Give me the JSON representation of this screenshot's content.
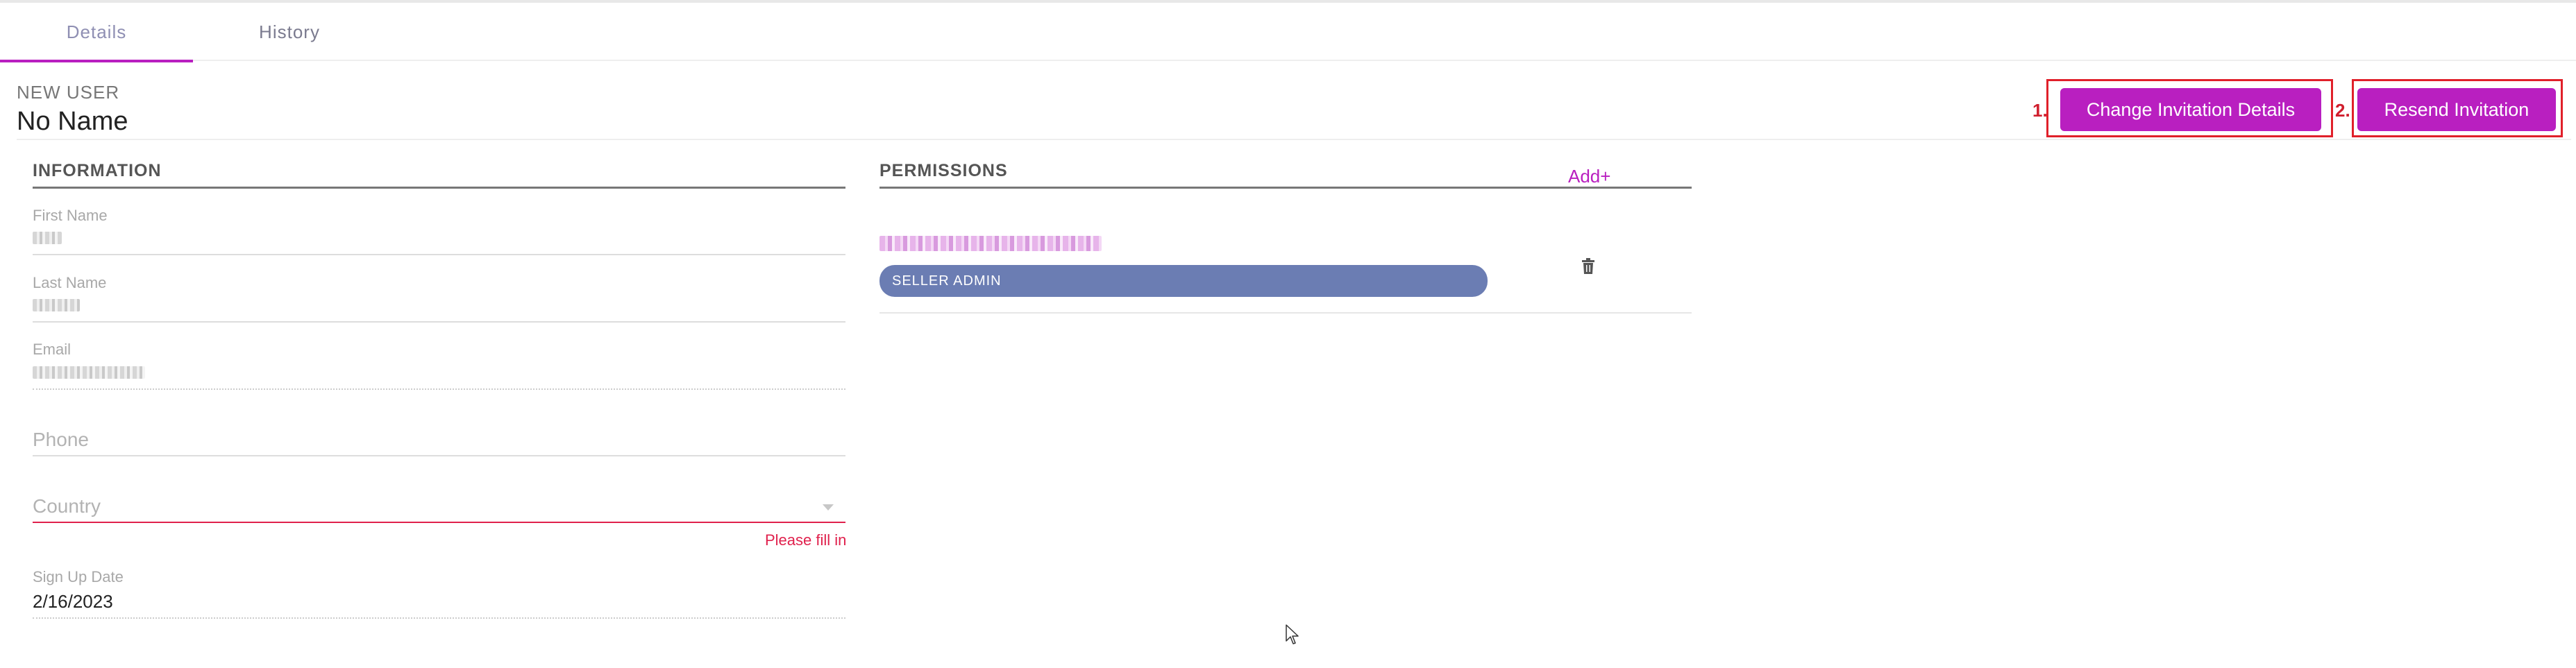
{
  "tabs": [
    {
      "label": "Details",
      "active": true
    },
    {
      "label": "History",
      "active": false
    }
  ],
  "header": {
    "subtitle": "NEW USER",
    "name": "No Name"
  },
  "actions": {
    "change_label": "Change Invitation Details",
    "change_annotation": "1.",
    "resend_label": "Resend Invitation",
    "resend_annotation": "2."
  },
  "information": {
    "title": "INFORMATION",
    "first_name_label": "First Name",
    "last_name_label": "Last Name",
    "email_label": "Email",
    "phone_placeholder": "Phone",
    "country_placeholder": "Country",
    "country_error": "Please fill in",
    "signup_label": "Sign Up Date",
    "signup_value": "2/16/2023"
  },
  "permissions": {
    "title": "PERMISSIONS",
    "add_label": "Add+",
    "role": "SELLER ADMIN"
  },
  "colors": {
    "accent": "#b91fc0",
    "pill": "#6b7db3",
    "error": "#e0204c",
    "annotation": "#e0202a"
  }
}
